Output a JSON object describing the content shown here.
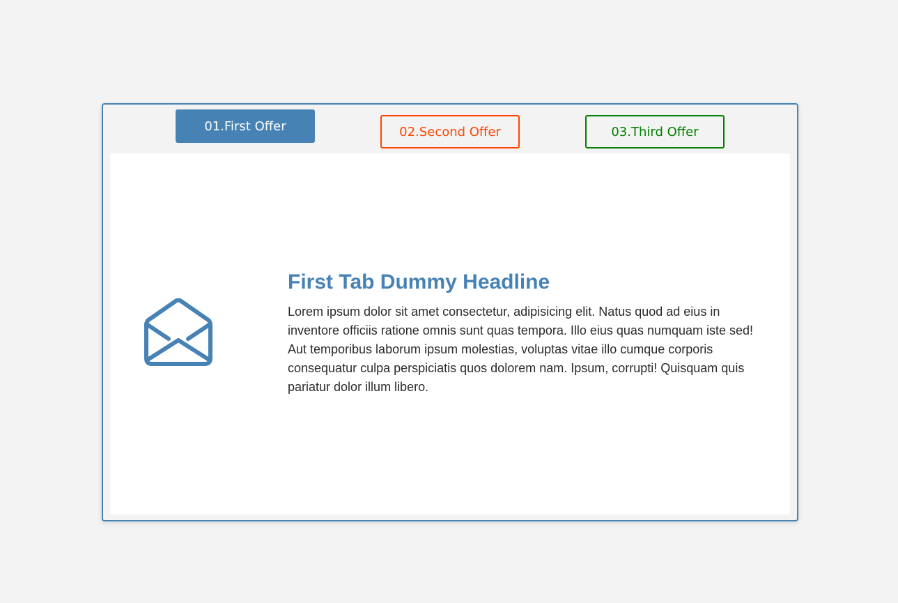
{
  "tabs": [
    {
      "label": "01.First Offer",
      "color": "#4682b4",
      "active": true
    },
    {
      "label": "02.Second Offer",
      "color": "#ff4500",
      "active": false
    },
    {
      "label": "03.Third Offer",
      "color": "#008000",
      "active": false
    }
  ],
  "panel": {
    "icon": "envelope-open-icon",
    "headline": "First Tab Dummy Headline",
    "body": "Lorem ipsum dolor sit amet consectetur, adipisicing elit. Natus quod ad eius in inventore officiis ratione omnis sunt quas tempora. Illo eius quas numquam iste sed! Aut temporibus laborum ipsum molestias, voluptas vitae illo cumque corporis consequatur culpa perspiciatis quos dolorem nam. Ipsum, corrupti! Quisquam quis pariatur dolor illum libero."
  },
  "colors": {
    "accent": "#4682b4",
    "page_background": "#f3f3f3",
    "panel_background": "#ffffff"
  }
}
